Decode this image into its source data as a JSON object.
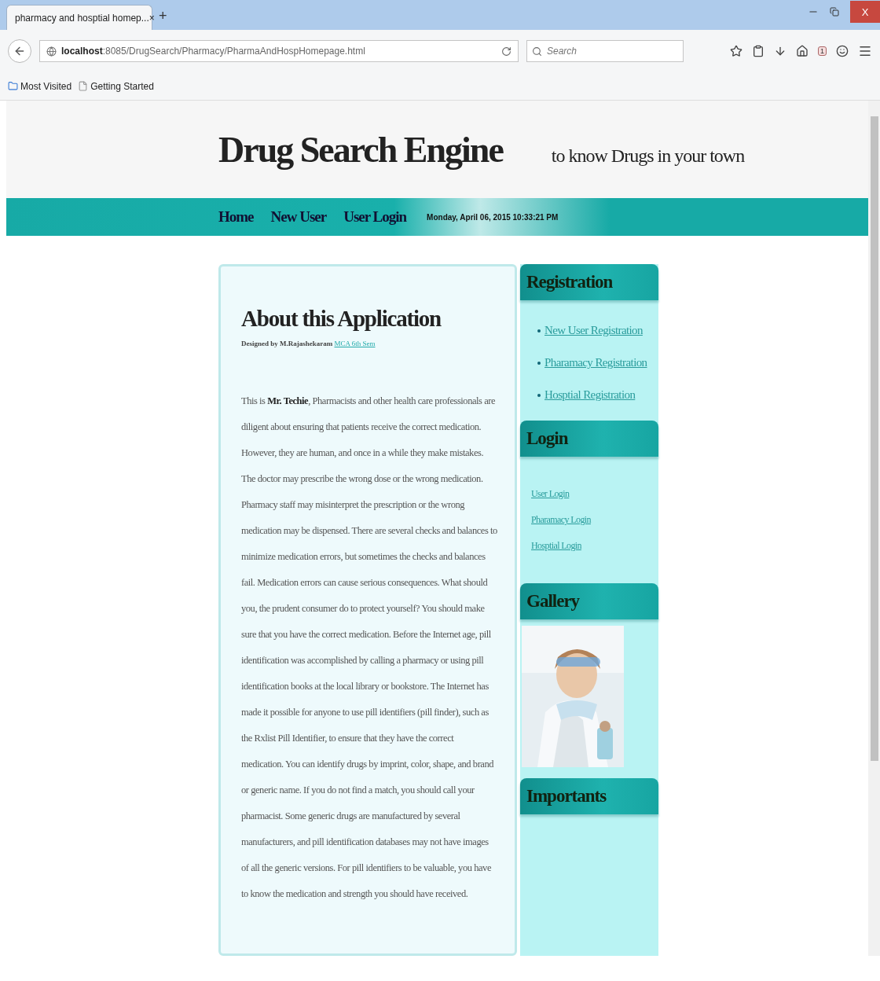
{
  "browser": {
    "tab": {
      "title": "pharmacy and hosptial homep...",
      "close": "×"
    },
    "new_tab": "+",
    "close_window": "X",
    "address": "**localhost**:8085/DrugSearch/Pharmacy/PharmaAndHospHomepage.html",
    "search": {
      "placeholder": "Search"
    },
    "badge": "1",
    "bookmarks": [
      {
        "label": "Most Visited",
        "kind": "folder"
      },
      {
        "label": "Getting Started",
        "kind": "page"
      }
    ]
  },
  "page": {
    "site_title": "Drug Search Engine",
    "tagline": "to know Drugs in your town",
    "nav": [
      {
        "label": "Home"
      },
      {
        "label": "New User"
      },
      {
        "label": "User Login"
      }
    ],
    "datetime": "Monday, April 06, 2015 10:33:21 PM",
    "main": {
      "heading": "About this Application",
      "credit": "Designed by M.Rajashekaram",
      "credit_link": "MCA 6th Sem",
      "paragraph": "This is **Mr. Techie**, Pharmacists and other health care professionals are diligent about ensuring that patients receive the correct medication. However, they are human, and once in a while they make mistakes. The doctor may prescribe the wrong dose or the wrong medication. Pharmacy staff may misinterpret the prescription or the wrong medication may be dispensed. There are several checks and balances to minimize medication errors, but sometimes the checks and balances fail. Medication errors can cause serious consequences. What should you, the prudent consumer do to protect yourself? You should make sure that you have the correct medication. Before the Internet age, pill identification was accomplished by calling a pharmacy or using pill identification books at the local library or bookstore. The Internet has made it possible for anyone to use pill identifiers (pill finder), such as the Rxlist Pill Identifier, to ensure that they have the correct medication. You can identify drugs by imprint, color, shape, and brand or generic name. If you do not find a match, you should call your pharmacist. Some generic drugs are manufactured by several manufacturers, and pill identification databases may not have images of all the generic versions. For pill identifiers to be valuable, you have to know the medication and strength you should have received."
    },
    "sidebar": [
      {
        "title": "Registration",
        "kind": "bulleted",
        "links": [
          "New User Registration",
          "Pharamacy Registration",
          "Hosptial Registration"
        ]
      },
      {
        "title": "Login",
        "kind": "plain",
        "links": [
          "User Login",
          "Pharamacy Login",
          "Hosptial Login"
        ]
      },
      {
        "title": "Gallery",
        "kind": "picture"
      },
      {
        "title": "Importants",
        "kind": "empty"
      }
    ]
  }
}
